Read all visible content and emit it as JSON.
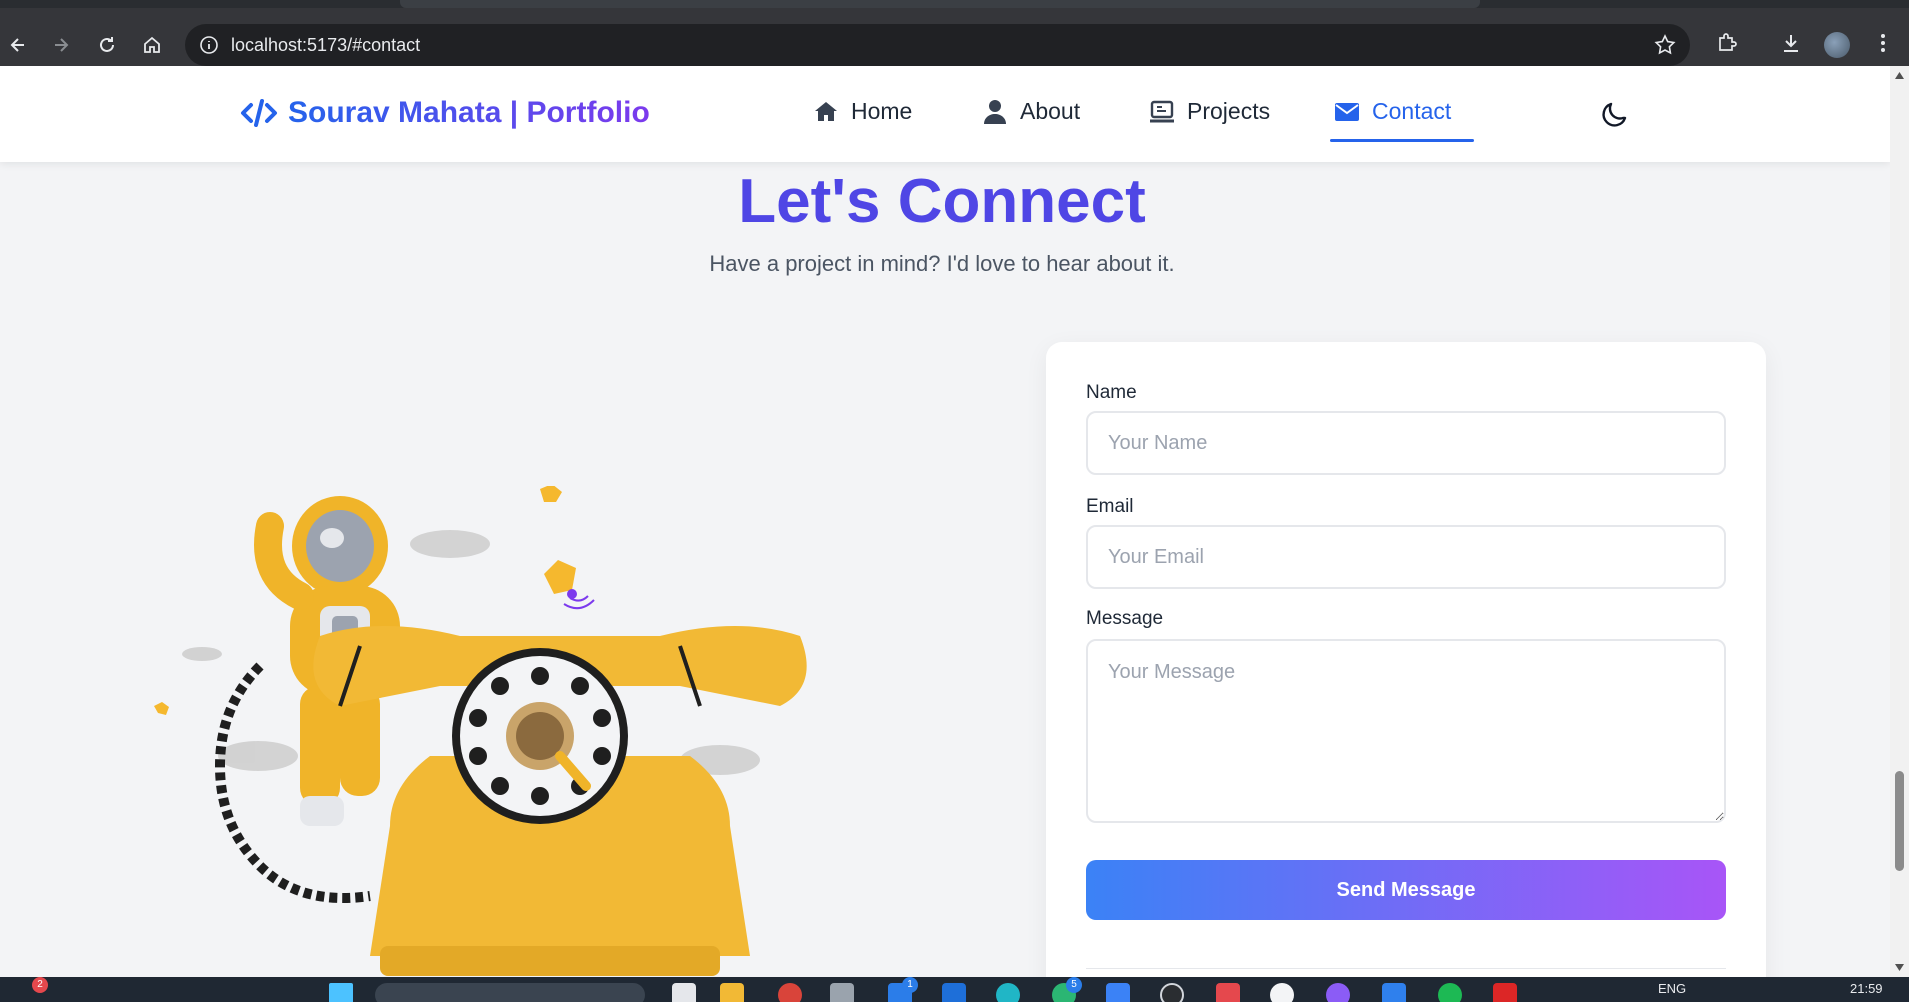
{
  "browser": {
    "url": "localhost:5173/#contact"
  },
  "navbar": {
    "brand": "Sourav Mahata | Portfolio",
    "links": [
      {
        "label": "Home",
        "icon": "home-icon"
      },
      {
        "label": "About",
        "icon": "user-icon"
      },
      {
        "label": "Projects",
        "icon": "laptop-icon"
      },
      {
        "label": "Contact",
        "icon": "envelope-icon",
        "active": true
      }
    ],
    "theme_toggle_icon": "moon-icon"
  },
  "contact": {
    "title": "Let's Connect",
    "subtitle": "Have a project in mind? I'd love to hear about it.",
    "form": {
      "name_label": "Name",
      "name_placeholder": "Your Name",
      "email_label": "Email",
      "email_placeholder": "Your Email",
      "message_label": "Message",
      "message_placeholder": "Your Message",
      "submit_label": "Send Message"
    }
  },
  "taskbar": {
    "notification_count": "2",
    "app_badges": [
      "1",
      "5"
    ],
    "language": "ENG",
    "time": "21:59"
  },
  "colors": {
    "accent_blue": "#2563eb",
    "accent_purple": "#7c3aed",
    "heading": "#4f46e5"
  }
}
